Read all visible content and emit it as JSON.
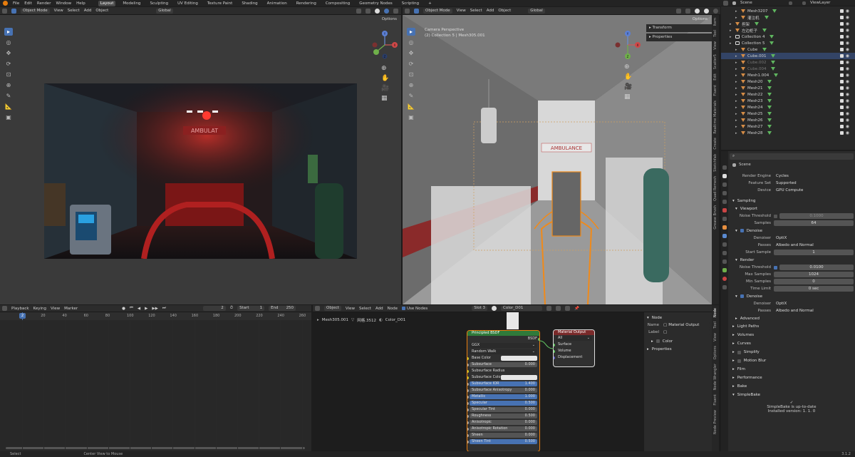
{
  "topbar": {
    "menus": [
      "File",
      "Edit",
      "Render",
      "Window",
      "Help"
    ],
    "workspaces": [
      "Layout",
      "Modeling",
      "Sculpting",
      "UV Editing",
      "Texture Paint",
      "Shading",
      "Animation",
      "Rendering",
      "Compositing",
      "Geometry Nodes",
      "Scripting",
      "+"
    ],
    "active_workspace": "Layout"
  },
  "left_viewport": {
    "mode": "Object Mode",
    "menus": [
      "View",
      "Select",
      "Add",
      "Object"
    ],
    "transform": "Global",
    "options": "Options"
  },
  "right_viewport": {
    "mode": "Object Mode",
    "menus": [
      "View",
      "Select",
      "Add",
      "Object"
    ],
    "transform": "Global",
    "options": "Options",
    "camera_label": "Camera Perspective",
    "collection_label": "(2) Collection 5 | Mesh305.001",
    "panel_transform": "Transform",
    "panel_properties": "Properties",
    "sign_text": "AMBULANCE",
    "side_tabs": [
      "Item",
      "Tool",
      "View",
      "Scatter5",
      "Edit",
      "Fluent",
      "Realtime Materials",
      "Create",
      "Sketchfab",
      "Quad Remesh",
      "Grease Brush"
    ]
  },
  "render_sign_text": "AMBULAT",
  "axis": {
    "x": "X",
    "y": "Y",
    "z": "Z"
  },
  "outliner": {
    "search": "Scene",
    "view_layer": "ViewLayer",
    "rows": [
      {
        "name": "Mesh3207",
        "type": "mesh",
        "indent": 2
      },
      {
        "name": "灌注机",
        "type": "mesh",
        "indent": 2
      },
      {
        "name": "担架",
        "type": "mesh",
        "indent": 1
      },
      {
        "name": "左边柜子",
        "type": "mesh",
        "indent": 1
      },
      {
        "name": "Collection 4",
        "type": "collection",
        "indent": 1
      },
      {
        "name": "Collection 5",
        "type": "collection",
        "indent": 1
      },
      {
        "name": "Cube",
        "type": "mesh",
        "indent": 2
      },
      {
        "name": "Cube.001",
        "type": "mesh",
        "indent": 2
      },
      {
        "name": "Cube.002",
        "type": "mesh",
        "indent": 2,
        "dim": true
      },
      {
        "name": "Cube.004",
        "type": "mesh",
        "indent": 2,
        "dim": true
      },
      {
        "name": "Mesh1.004",
        "type": "mesh",
        "indent": 2
      },
      {
        "name": "Mesh20",
        "type": "mesh",
        "indent": 2
      },
      {
        "name": "Mesh21",
        "type": "mesh",
        "indent": 2
      },
      {
        "name": "Mesh22",
        "type": "mesh",
        "indent": 2
      },
      {
        "name": "Mesh23",
        "type": "mesh",
        "indent": 2
      },
      {
        "name": "Mesh24",
        "type": "mesh",
        "indent": 2
      },
      {
        "name": "Mesh25",
        "type": "mesh",
        "indent": 2
      },
      {
        "name": "Mesh26",
        "type": "mesh",
        "indent": 2
      },
      {
        "name": "Mesh27",
        "type": "mesh",
        "indent": 2
      },
      {
        "name": "Mesh28",
        "type": "mesh",
        "indent": 2
      }
    ]
  },
  "properties": {
    "scene_name": "Scene",
    "render_engine_label": "Render Engine",
    "render_engine": "Cycles",
    "feature_set_label": "Feature Set",
    "feature_set": "Supported",
    "device_label": "Device",
    "device": "GPU Compute",
    "sampling": "Sampling",
    "viewport": "Viewport",
    "vp_noise_label": "Noise Threshold",
    "vp_noise": "0.1000",
    "vp_samples_label": "Samples",
    "vp_samples": "64",
    "denoise": "Denoise",
    "denoiser_label": "Denoiser",
    "denoiser": "OptiX",
    "passes_label": "Passes",
    "passes": "Albedo and Normal",
    "start_sample_label": "Start Sample",
    "start_sample": "1",
    "render": "Render",
    "r_noise_label": "Noise Threshold",
    "r_noise": "0.0100",
    "max_samples_label": "Max Samples",
    "max_samples": "1024",
    "min_samples_label": "Min Samples",
    "min_samples": "0",
    "time_limit_label": "Time Limit",
    "time_limit": "0 sec",
    "denoise2": "Denoise",
    "denoiser2_label": "Denoiser",
    "denoiser2": "OptiX",
    "passes2_label": "Passes",
    "passes2": "Albedo and Normal",
    "collapsed": [
      "Advanced",
      "Light Paths",
      "Volumes",
      "Curves",
      "Simplify",
      "Motion Blur",
      "Film",
      "Performance",
      "Bake",
      "SimpleBake"
    ],
    "footer1": "SimpleBake is up-to-date",
    "footer2": "Installed version: 1. 1. 0"
  },
  "timeline": {
    "menus": [
      "Playback",
      "Keying",
      "View",
      "Marker"
    ],
    "current_frame": "2",
    "start_label": "Start",
    "start": "1",
    "end_label": "End",
    "end": "250",
    "ticks": [
      "2",
      "20",
      "40",
      "60",
      "80",
      "100",
      "120",
      "140",
      "160",
      "180",
      "200",
      "220",
      "240",
      "260"
    ]
  },
  "node_editor": {
    "object": "Object",
    "menus": [
      "View",
      "Select",
      "Add",
      "Node"
    ],
    "use_nodes": "Use Nodes",
    "slot": "Slot 3",
    "material": "Color_D01",
    "breadcrumb": [
      "Mesh305.001",
      "网格.3512",
      "Color_D01"
    ],
    "bsdf_title": "Principled BSDF",
    "bsdf_out": "BSDF",
    "ggx": "GGX",
    "random_walk": "Random Walk",
    "inputs": [
      {
        "label": "Base Color",
        "kind": "color"
      },
      {
        "label": "Subsurface",
        "value": "0.000"
      },
      {
        "label": "Subsurface Radius",
        "kind": "plain"
      },
      {
        "label": "Subsurface Colo",
        "kind": "color"
      },
      {
        "label": "Subsurface IOR",
        "value": "1.400",
        "blue": true
      },
      {
        "label": "Subsurface Anisotropy",
        "value": "0.000"
      },
      {
        "label": "Metallic",
        "value": "1.000",
        "blue": true
      },
      {
        "label": "Specular",
        "value": "0.500",
        "blue": true
      },
      {
        "label": "Specular Tint",
        "value": "0.000"
      },
      {
        "label": "Roughness",
        "value": "0.500"
      },
      {
        "label": "Anisotropic",
        "value": "0.000"
      },
      {
        "label": "Anisotropic Rotation",
        "value": "0.000"
      },
      {
        "label": "Sheen",
        "value": "0.000"
      },
      {
        "label": "Sheen Tint",
        "value": "0.500",
        "blue": true
      }
    ],
    "output_title": "Material Output",
    "output_target": "All",
    "output_sockets": [
      "Surface",
      "Volume",
      "Displacement"
    ],
    "side_panel_title": "Node",
    "name_label": "Name",
    "name_value": "Material Output",
    "label_label": "Label",
    "color_label": "Color",
    "properties_label": "Properties",
    "side_tabs": [
      "Node",
      "Tool",
      "View",
      "Options",
      "Node Wrangler",
      "Fluent",
      "Node Preview"
    ]
  },
  "statusbar": [
    "Select",
    "Center View to Mouse"
  ],
  "version": "3.1.2"
}
